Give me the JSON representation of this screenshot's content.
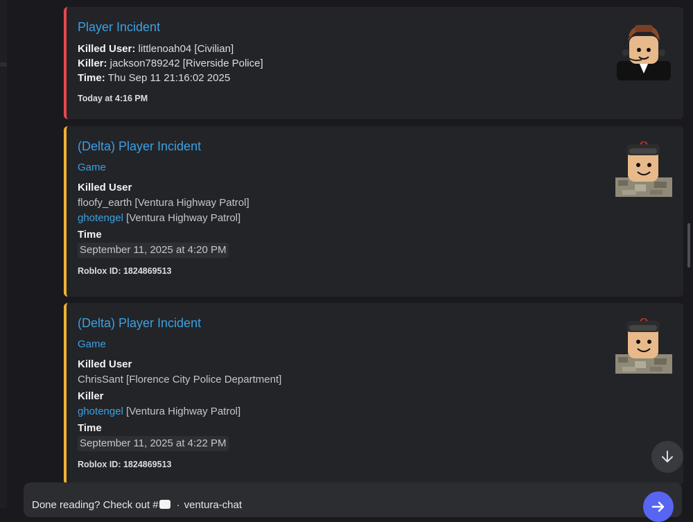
{
  "colors": {
    "accent_red": "#e5484d",
    "accent_yellow": "#f0b132",
    "link_blue": "#3aa1e4",
    "send_button": "#5865f2"
  },
  "embeds": [
    {
      "title": "Player Incident",
      "lines": [
        {
          "label": "Killed User:",
          "value": " littlenoah04 [Civilian]"
        },
        {
          "label": "Killer:",
          "value": " jackson789242 [Riverside Police]"
        },
        {
          "label": "Time:",
          "value": " Thu Sep 11 21:16:02 2025"
        }
      ],
      "footer": "Today at 4:16 PM",
      "thumbnail_icon": "roblox-avatar-headset"
    },
    {
      "title": "(Delta) Player Incident",
      "game_link": "Game",
      "fields": {
        "killed_user_label": "Killed User",
        "killed_user_line1": "floofy_earth [Ventura Highway Patrol]",
        "killer_link": "ghotengel",
        "killer_team": " [Ventura Highway Patrol]",
        "time_label": "Time",
        "time_value": "September 11, 2025 at 4:20 PM"
      },
      "footer": "Roblox ID: 1824869513",
      "thumbnail_icon": "roblox-avatar-camo"
    },
    {
      "title": "(Delta) Player Incident",
      "game_link": "Game",
      "fields": {
        "killed_user_label": "Killed User",
        "killed_user_value": "ChrisSant [Florence City Police Department]",
        "killer_label": "Killer",
        "killer_link": "ghotengel",
        "killer_team": " [Ventura Highway Patrol]",
        "time_label": "Time",
        "time_value": "September 11, 2025 at 4:22 PM"
      },
      "footer": "Roblox ID: 1824869513",
      "thumbnail_icon": "roblox-avatar-camo"
    }
  ],
  "composer": {
    "prefix": "Done reading? Check out #",
    "channel": "ventura-chat",
    "separator": "·"
  }
}
